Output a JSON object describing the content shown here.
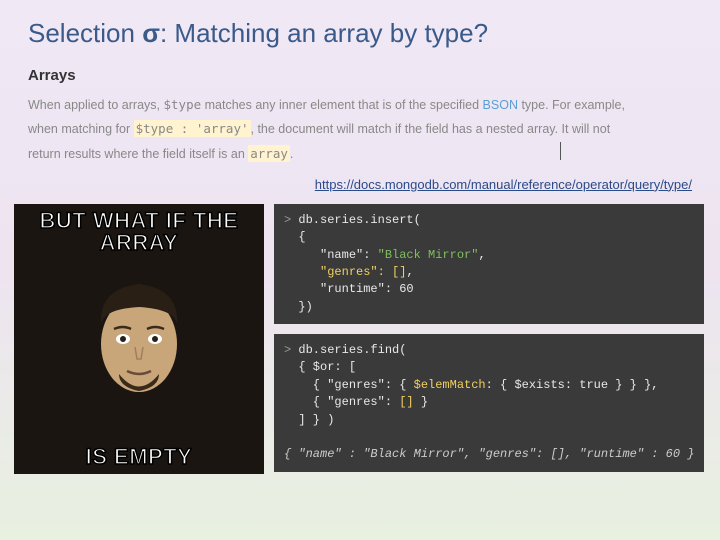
{
  "title_prefix": "Selection ",
  "sigma": "σ",
  "title_suffix": ": Matching an array by type?",
  "arrays_heading": "Arrays",
  "para1_a": "When applied to arrays, ",
  "para1_code1": "$type",
  "para1_b": " matches any inner element that is of the specified ",
  "para1_bson": "BSON",
  "para1_c": " type. For example,",
  "para2_a": "when matching for ",
  "para2_code1": "$type : 'array'",
  "para2_b": ", the document will match if the field has a nested array. It will not",
  "para3_a": "return results where the field itself is an ",
  "para3_code1": "array",
  "para3_b": ".",
  "doclink": "https://docs.mongodb.com/manual/reference/operator/query/type/",
  "meme_top": "BUT WHAT IF THE ARRAY",
  "meme_bottom": "IS EMPTY",
  "code1_prompt": ">",
  "code1_l1": "db.series.insert(",
  "code1_l2": "{",
  "code1_l3a": "   \"name\": ",
  "code1_l3b": "\"Black Mirror\"",
  "code1_l3c": ",",
  "code1_l4a": "   ",
  "code1_l4b": "\"genres\": []",
  "code1_l4c": ",",
  "code1_l5": "   \"runtime\": 60",
  "code1_l6": "})",
  "code2_prompt": ">",
  "code2_l1": "db.series.find(",
  "code2_l2": "{ $or: [",
  "code2_l3a": "  { \"genres\": { ",
  "code2_l3b": "$elemMatch",
  "code2_l3c": ": { $exists: true } } },",
  "code2_l4a": "  { \"genres\": ",
  "code2_l4b": "[]",
  "code2_l4c": " }",
  "code2_l5": "] } )",
  "code2_blank": "",
  "code2_res": "{ \"name\" : \"Black Mirror\", \"genres\": [], \"runtime\" : 60 }"
}
